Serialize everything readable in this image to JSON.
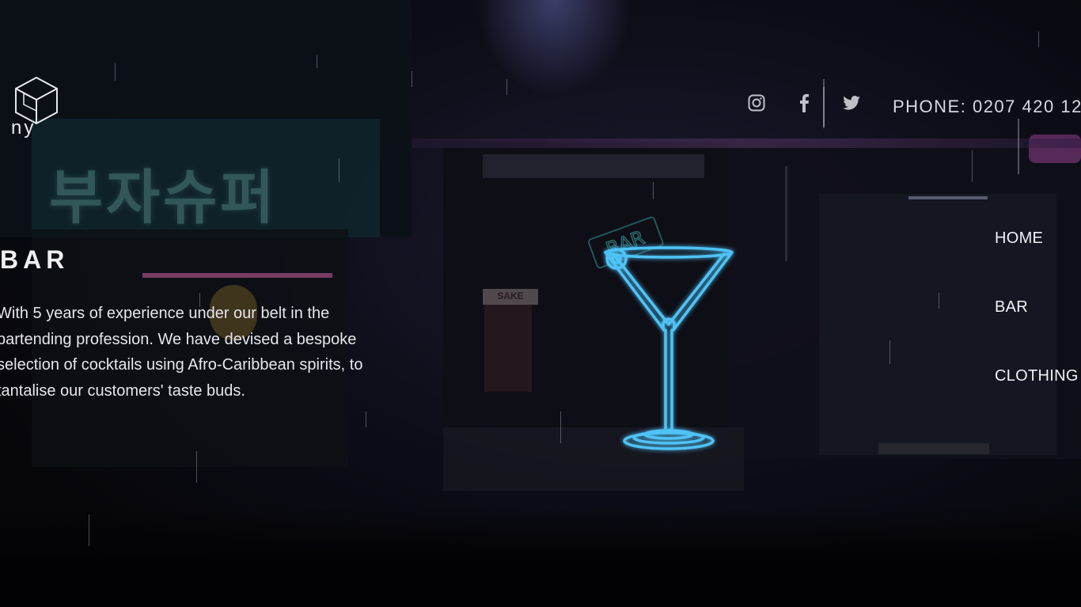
{
  "header": {
    "logo_text": "ny",
    "social": [
      "instagram-icon",
      "facebook-icon",
      "twitter-icon"
    ],
    "phone": "PHONE: 0207 420 12"
  },
  "background": {
    "sign_korean": "부자슈퍼",
    "sign_bar": "BAR",
    "sign_sake": "SAKE"
  },
  "nav": {
    "items": [
      {
        "label": "HOME"
      },
      {
        "label": "BAR"
      },
      {
        "label": "CLOTHING"
      }
    ]
  },
  "main": {
    "heading": "BAR",
    "paragraph_lines": [
      "With 5 years of experience under our belt in the",
      "bartending profession. We have devised a bespoke",
      "selection of cocktails using Afro-Caribbean spirits, to",
      "tantalise our customers' taste buds."
    ]
  },
  "colors": {
    "neon_blue": "#4fc3f7",
    "accent_pink": "#d870c8",
    "text": "#e9e9f0"
  }
}
